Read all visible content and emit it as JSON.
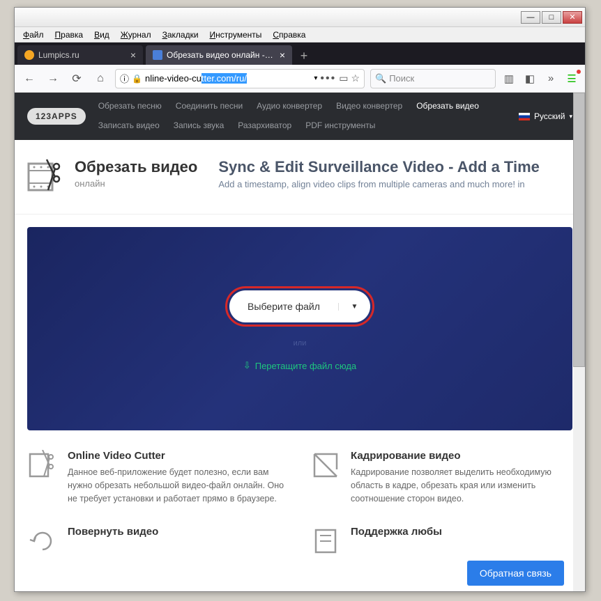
{
  "menubar": [
    "Файл",
    "Правка",
    "Вид",
    "Журнал",
    "Закладки",
    "Инструменты",
    "Справка"
  ],
  "tabs": [
    {
      "label": "Lumpics.ru",
      "active": false,
      "favicon": "orange"
    },
    {
      "label": "Обрезать видео онлайн - обр",
      "active": true,
      "favicon": "blue"
    }
  ],
  "url": {
    "pre": "nline-video-cu",
    "sel": "tter.com/ru/"
  },
  "search_placeholder": "Поиск",
  "topnav": {
    "brand": "123APPS",
    "links": [
      "Обрезать песню",
      "Соединить песни",
      "Аудио конвертер",
      "Видео конвертер",
      "Обрезать видео",
      "Записать видео",
      "Запись звука",
      "Разархиватор",
      "PDF инструменты"
    ],
    "active": "Обрезать видео",
    "lang": "Русский"
  },
  "header": {
    "title": "Обрезать видео",
    "subtitle": "онлайн",
    "ad_title": "Sync & Edit Surveillance Video - Add a Time",
    "ad_text": "Add a timestamp, align video clips from multiple cameras and much more! in"
  },
  "hero": {
    "button": "Выберите файл",
    "or": "или",
    "drop": "Перетащите файл сюда"
  },
  "features": [
    {
      "title": "Online Video Cutter",
      "text": "Данное веб-приложение будет полезно, если вам нужно обрезать небольшой видео-файл онлайн. Оно не требует установки и работает прямо в браузере."
    },
    {
      "title": "Кадрирование видео",
      "text": "Кадрирование позволяет выделить необходимую область в кадре, обрезать края или изменить соотношение сторон видео."
    },
    {
      "title": "Повернуть видео",
      "text": ""
    },
    {
      "title": "Поддержка любы",
      "text": ""
    }
  ],
  "feedback": "Обратная связь"
}
